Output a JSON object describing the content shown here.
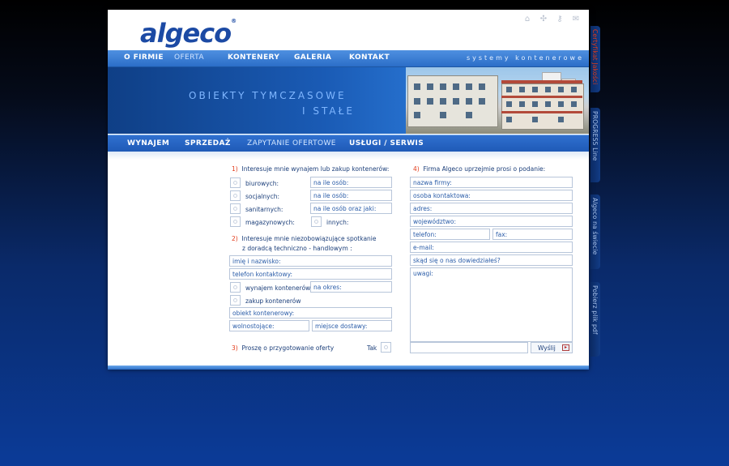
{
  "header": {
    "logo": "algeco",
    "logo_mark": "®",
    "icons": [
      "home-icon",
      "sitemap-icon",
      "key-icon",
      "mail-icon"
    ]
  },
  "topnav": {
    "items": [
      "O FIRMIE",
      "OFERTA",
      "KONTENERY",
      "GALERIA",
      "KONTAKT"
    ],
    "active": "OFERTA",
    "tagline": "systemy kontenerowe"
  },
  "banner": {
    "line1": "OBIEKTY  TYMCZASOWE",
    "line2": "I  STAŁE"
  },
  "subnav": {
    "items": [
      "WYNAJEM",
      "SPRZEDAŻ",
      "ZAPYTANIE OFERTOWE",
      "USŁUGI / SERWIS"
    ],
    "active": "ZAPYTANIE OFERTOWE"
  },
  "form": {
    "s1": {
      "num": "1)",
      "title": "Interesuje mnie wynajem lub zakup kontenerów:"
    },
    "s1_rows": [
      {
        "label": "biurowych:",
        "field": "na ile osób:"
      },
      {
        "label": "socjalnych:",
        "field": "na ile osób:"
      },
      {
        "label": "sanitarnych:",
        "field": "na ile osób oraz jaki:"
      },
      {
        "label": "magazynowych:",
        "other_label": "innych:"
      }
    ],
    "s2": {
      "num": "2)",
      "title_line1": "Interesuje mnie niezobowiązujące  spotkanie",
      "title_line2": "z doradcą techniczno - handlowym :"
    },
    "s2_fields": {
      "name": "imię i nazwisko:",
      "phone": "telefon kontaktowy:",
      "rent": "wynajem kontenerów",
      "period": "na okres:",
      "buy": "zakup kontenerów",
      "object": "obiekt kontenerowy:",
      "standalone": "wolnostojące:",
      "delivery": "miejsce dostawy:"
    },
    "s3": {
      "num": "3)",
      "title": "Proszę o przygotowanie oferty",
      "yes": "Tak"
    },
    "s4": {
      "num": "4)",
      "title": "Firma Algeco uprzejmie prosi o podanie:"
    },
    "s4_fields": {
      "company": "nazwa firmy:",
      "contact": "osoba kontaktowa:",
      "address": "adres:",
      "region": "województwo:",
      "phone": "telefon:",
      "fax": "fax:",
      "email": "e-mail:",
      "source": "skąd się o nas dowiedziałeś?",
      "notes": "uwagi:"
    },
    "send": "Wyślij"
  },
  "side_tabs": [
    "Certyfikat Jakości",
    "PROGRESS Line",
    "Algeco na świecie",
    "Pobierz plik pdf"
  ],
  "colors": {
    "brand": "#1c4aa4",
    "accent": "#e23b1a",
    "nav": "#2b6ec8"
  }
}
